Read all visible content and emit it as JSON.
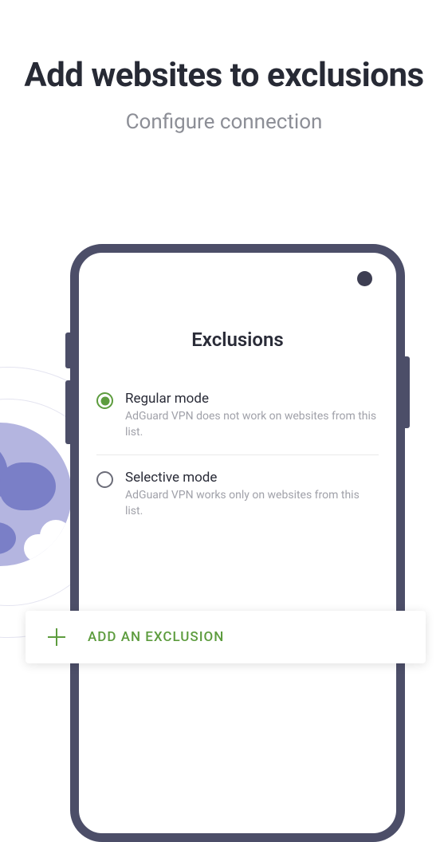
{
  "header": {
    "title": "Add websites to exclusions",
    "subtitle": "Configure connection"
  },
  "phone": {
    "screen_title": "Exclusions",
    "modes": [
      {
        "label": "Regular mode",
        "description": "AdGuard VPN does not work on websites from this list.",
        "selected": true
      },
      {
        "label": "Selective mode",
        "description": "AdGuard VPN works only on websites from this list.",
        "selected": false
      }
    ],
    "add_button": "ADD AN EXCLUSION"
  }
}
